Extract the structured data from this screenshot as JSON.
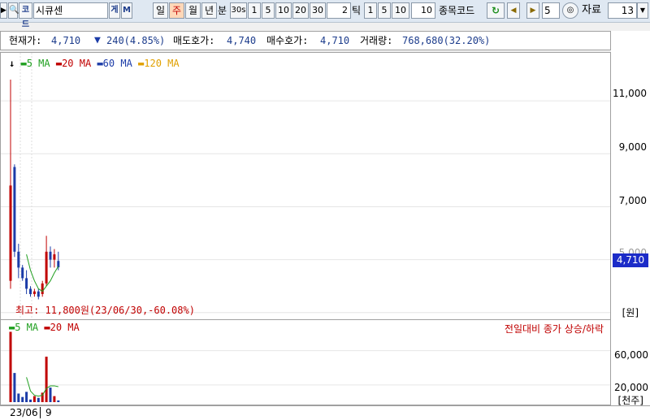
{
  "toolbar": {
    "stock_name": "시큐센",
    "code_btn": "코드",
    "g_btn": "게",
    "m_btn": "M",
    "periods": [
      "일",
      "주",
      "월",
      "년"
    ],
    "selected_period": "주",
    "minute_label": "분",
    "minute_values": [
      "30s",
      "1",
      "5",
      "10",
      "20",
      "30"
    ],
    "minute_input": "2",
    "tick_label": "틱",
    "tick_values": [
      "1",
      "5",
      "10"
    ],
    "tick_input": "10",
    "stock_code_label": "종목코드",
    "step_input": "5",
    "data_label": "자료",
    "data_count": "13"
  },
  "quote": {
    "current_label": "현재가:",
    "current_value": "4,710",
    "change_text": "240(4.85%)",
    "ask_label": "매도호가:",
    "ask_value": "4,740",
    "bid_label": "매수호가:",
    "bid_value": "4,710",
    "volume_label": "거래량:",
    "volume_value": "768,680(32.20%)"
  },
  "price_pane": {
    "legend": [
      {
        "label": "5 MA",
        "color": "#1f9f1f"
      },
      {
        "label": "20 MA",
        "color": "#c00000"
      },
      {
        "label": "60 MA",
        "color": "#1c3ca8"
      },
      {
        "label": "120 MA",
        "color": "#e0a000"
      }
    ],
    "y_labels": [
      "11,000",
      "9,000",
      "7,000",
      "5,000"
    ],
    "current_price_tag": "4,710",
    "max_text": "최고: 11,800원(23/06/30,-60.08%)",
    "unit": "[원]"
  },
  "volume_pane": {
    "legend": [
      {
        "label": "5 MA",
        "color": "#1f9f1f"
      },
      {
        "label": "20 MA",
        "color": "#c00000"
      }
    ],
    "caption": "전일대비 종가 상승/하락",
    "y_labels": [
      "60,000",
      "20,000"
    ],
    "unit": "[천주]"
  },
  "xaxis": {
    "labels": [
      "23/06",
      "9"
    ]
  },
  "colors": {
    "up": "#c00000",
    "down": "#1c3ca8",
    "ma5": "#1f9f1f",
    "tag_bg": "#1c2cc8"
  },
  "chart_data": {
    "type": "candlestick",
    "price_candles": [
      {
        "o": 4200,
        "h": 11800,
        "l": 3900,
        "c": 7800,
        "dir": "up"
      },
      {
        "o": 8500,
        "h": 8600,
        "l": 5100,
        "c": 5300,
        "dir": "down"
      },
      {
        "o": 5300,
        "h": 5600,
        "l": 4300,
        "c": 4700,
        "dir": "down"
      },
      {
        "o": 4700,
        "h": 4800,
        "l": 4200,
        "c": 4300,
        "dir": "down"
      },
      {
        "o": 4300,
        "h": 4600,
        "l": 3700,
        "c": 3900,
        "dir": "down"
      },
      {
        "o": 3900,
        "h": 4000,
        "l": 3600,
        "c": 3700,
        "dir": "down"
      },
      {
        "o": 3700,
        "h": 3900,
        "l": 3600,
        "c": 3800,
        "dir": "up"
      },
      {
        "o": 3800,
        "h": 3900,
        "l": 3500,
        "c": 3600,
        "dir": "down"
      },
      {
        "o": 3700,
        "h": 4200,
        "l": 3600,
        "c": 4100,
        "dir": "up"
      },
      {
        "o": 4100,
        "h": 5900,
        "l": 4000,
        "c": 5300,
        "dir": "up"
      },
      {
        "o": 5300,
        "h": 5500,
        "l": 4700,
        "c": 5000,
        "dir": "down"
      },
      {
        "o": 5000,
        "h": 5400,
        "l": 4700,
        "c": 5200,
        "dir": "up"
      },
      {
        "o": 4950,
        "h": 5300,
        "l": 4600,
        "c": 4710,
        "dir": "down"
      }
    ],
    "price_ma5": [
      null,
      null,
      null,
      null,
      5200,
      4600,
      4200,
      3900,
      3800,
      4000,
      4200,
      4500,
      4750
    ],
    "volumes": [
      {
        "v": 82000,
        "dir": "up"
      },
      {
        "v": 34000,
        "dir": "down"
      },
      {
        "v": 10000,
        "dir": "down"
      },
      {
        "v": 6000,
        "dir": "down"
      },
      {
        "v": 12000,
        "dir": "down"
      },
      {
        "v": 3000,
        "dir": "down"
      },
      {
        "v": 7000,
        "dir": "up"
      },
      {
        "v": 5000,
        "dir": "down"
      },
      {
        "v": 11000,
        "dir": "up"
      },
      {
        "v": 53000,
        "dir": "up"
      },
      {
        "v": 17000,
        "dir": "down"
      },
      {
        "v": 7000,
        "dir": "up"
      },
      {
        "v": 2000,
        "dir": "down"
      }
    ],
    "volume_ma5": [
      null,
      null,
      null,
      null,
      29000,
      13000,
      8000,
      7000,
      8000,
      16000,
      19000,
      19000,
      18000
    ],
    "price_range": [
      3300,
      12200
    ],
    "volume_range": [
      0,
      90000
    ]
  }
}
